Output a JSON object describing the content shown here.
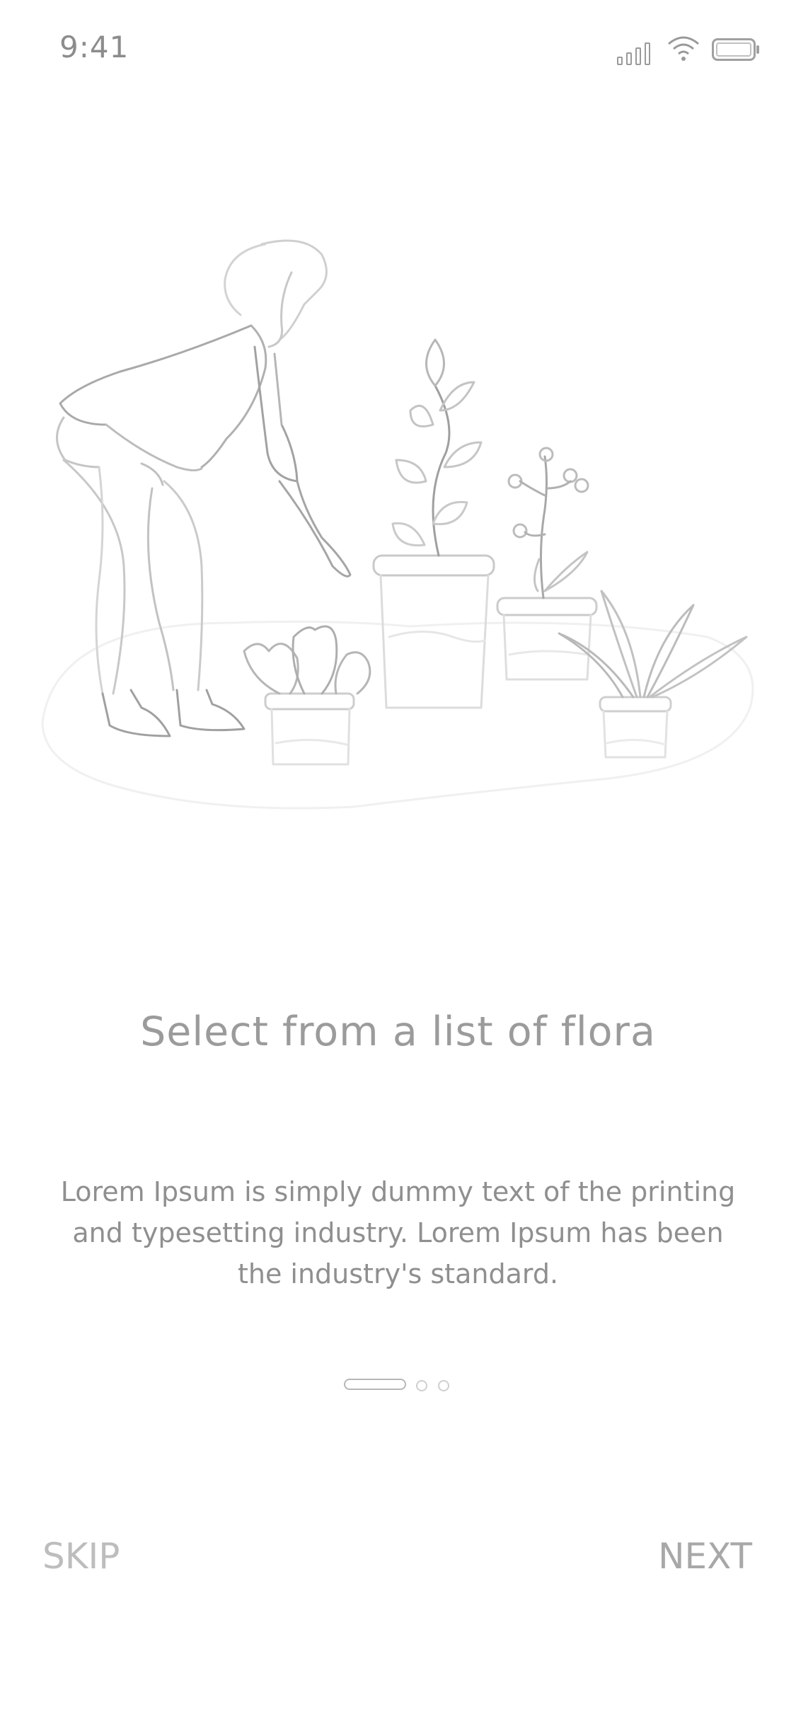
{
  "status_bar": {
    "time": "9:41",
    "icons": [
      "signal-icon",
      "wifi-icon",
      "battery-icon"
    ]
  },
  "illustration": {
    "icon": "woman-gardening-illustration"
  },
  "onboarding": {
    "title": "Select from a list of flora",
    "body": "Lorem Ipsum is simply dummy text of the printing and typesetting industry. Lorem Ipsum has been the industry's standard.",
    "page_current": 1,
    "page_total": 3
  },
  "actions": {
    "skip_label": "SKIP",
    "next_label": "NEXT"
  },
  "colors": {
    "background": "#ffffff",
    "text": "#8f8f8f",
    "muted": "#bdbdbd"
  }
}
